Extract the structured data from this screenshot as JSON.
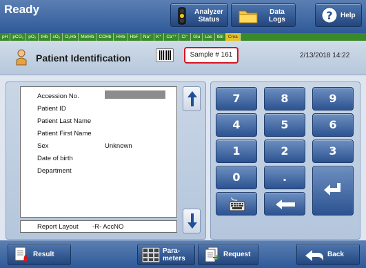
{
  "status": "Ready",
  "topbar": {
    "analyzer_status": [
      "Analyzer",
      "Status"
    ],
    "data_logs": [
      "Data",
      "Logs"
    ],
    "help": "Help"
  },
  "parameters": [
    "pH",
    "pCO₂",
    "pO₂",
    "tHb",
    "sO₂",
    "O₂Hb",
    "MetHb",
    "COHb",
    "HHb",
    "HbF",
    "Na⁺",
    "K⁺",
    "Ca⁺⁺",
    "Cl⁻",
    "Glu",
    "Lac",
    "tBil",
    "Crea"
  ],
  "header": {
    "title": "Patient Identification",
    "sample": "Sample # 161",
    "datetime": "2/13/2018 14:22"
  },
  "patient_fields": [
    {
      "label": "Accession No.",
      "value": ""
    },
    {
      "label": "Patient ID",
      "value": ""
    },
    {
      "label": "Patient Last Name",
      "value": ""
    },
    {
      "label": "Patient First Name",
      "value": ""
    },
    {
      "label": "Sex",
      "value": "Unknown"
    },
    {
      "label": "Date of birth",
      "value": ""
    },
    {
      "label": "Department",
      "value": ""
    }
  ],
  "report_layout": {
    "label": "Report Layout",
    "value": "-R- AccNO"
  },
  "keypad": {
    "k7": "7",
    "k8": "8",
    "k9": "9",
    "k4": "4",
    "k5": "5",
    "k6": "6",
    "k1": "1",
    "k2": "2",
    "k3": "3",
    "k0": "0",
    "dot": "."
  },
  "bottombar": {
    "result": "Result",
    "parameters": [
      "Para-",
      "meters"
    ],
    "request": "Request",
    "back": "Back"
  },
  "colors": {
    "bar_blue": "#2f5a98",
    "param_strip": "#3a8a2a",
    "highlight_param": "#e4c229",
    "sample_border": "#d8141e"
  }
}
